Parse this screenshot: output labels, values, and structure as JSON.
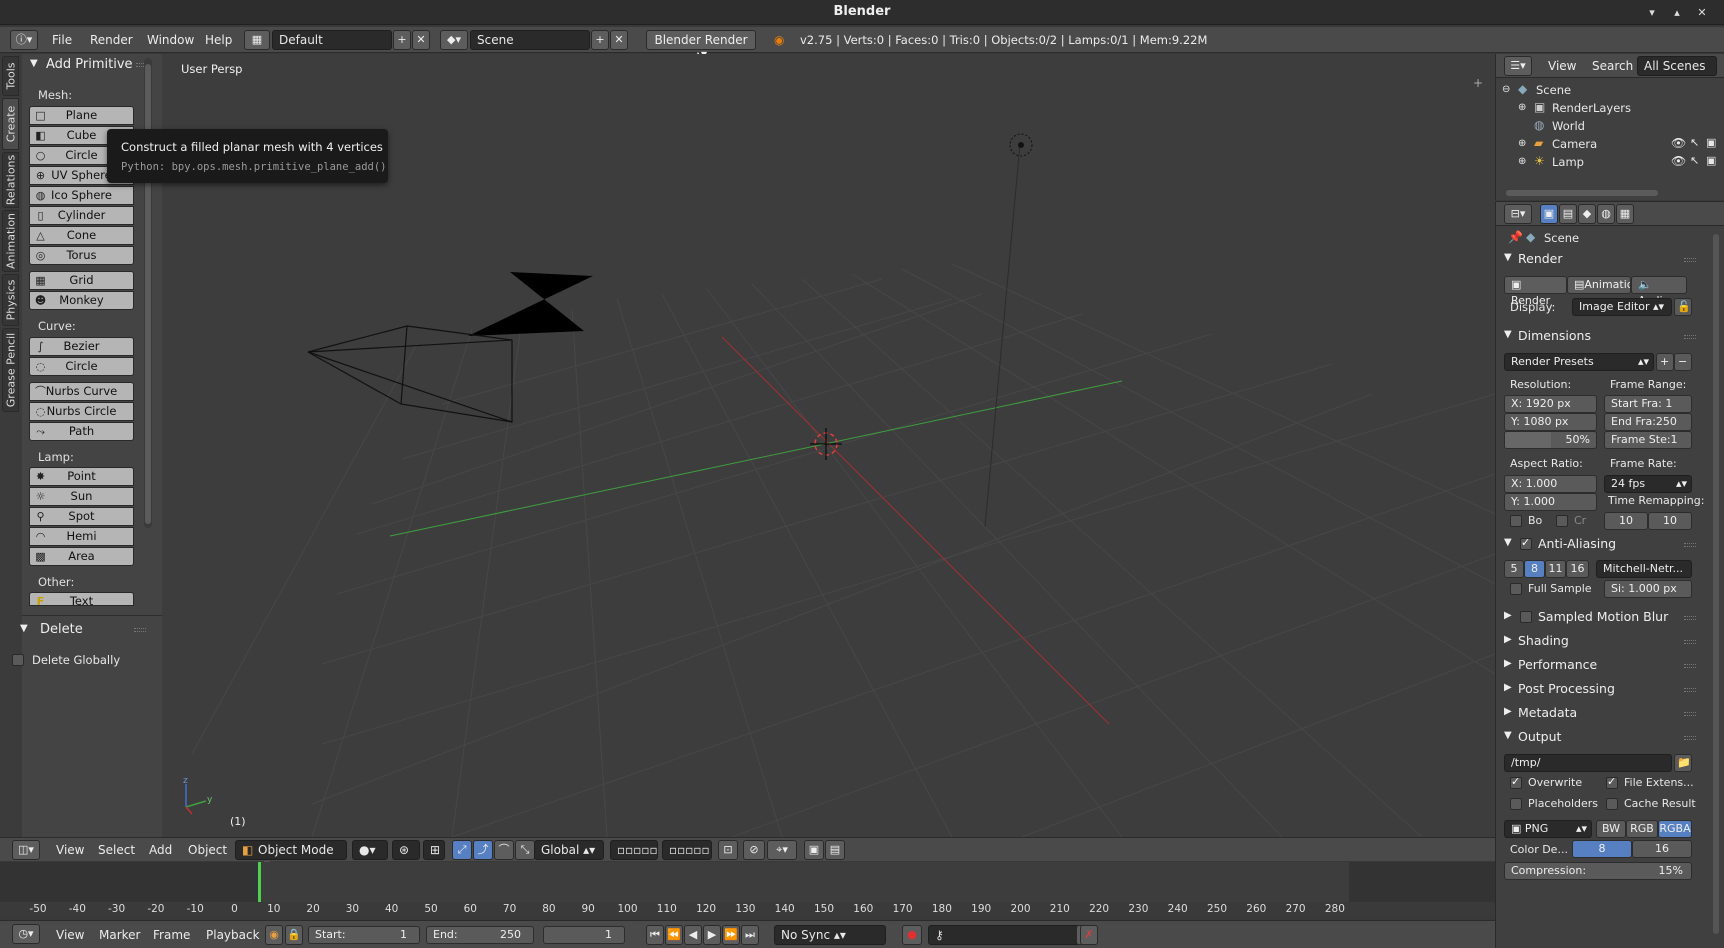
{
  "window": {
    "title": "Blender",
    "minimize": "▾",
    "maximize": "▴",
    "close": "✕"
  },
  "info": {
    "menus": [
      "File",
      "Render",
      "Window",
      "Help"
    ],
    "layout": "Default",
    "scene": "Scene",
    "engine": "Blender Render",
    "stats": "v2.75 | Verts:0 | Faces:0 | Tris:0 | Objects:0/2 | Lamps:0/1 | Mem:9.22M"
  },
  "tool_tabs": [
    "Tools",
    "Create",
    "Relations",
    "Animation",
    "Physics",
    "Grease Pencil"
  ],
  "toolshelf": {
    "panel_title": "Add Primitive",
    "mesh_label": "Mesh:",
    "mesh_items": [
      "Plane",
      "Cube",
      "Circle",
      "UV Sphere",
      "Ico Sphere",
      "Cylinder",
      "Cone",
      "Torus",
      "Grid",
      "Monkey"
    ],
    "curve_label": "Curve:",
    "curve_items": [
      "Bezier",
      "Circle",
      "Nurbs Curve",
      "Nurbs Circle",
      "Path"
    ],
    "lamp_label": "Lamp:",
    "lamp_items": [
      "Point",
      "Sun",
      "Spot",
      "Hemi",
      "Area"
    ],
    "other_label": "Other:",
    "other_items": [
      "Text"
    ],
    "delete_title": "Delete",
    "delete_globally": "Delete Globally"
  },
  "tooltip": {
    "title": "Construct a filled planar mesh with 4 vertices",
    "python": "Python: bpy.ops.mesh.primitive_plane_add()"
  },
  "viewport": {
    "label": "User Persp",
    "frame": "(1)",
    "x_axis_color": "#b03030",
    "y_axis_color": "#3f9f3f"
  },
  "vp_header": {
    "menus": [
      "View",
      "Select",
      "Add",
      "Object"
    ],
    "mode": "Object Mode",
    "orientation": "Global"
  },
  "timeline": {
    "ticks": [
      "-50",
      "-40",
      "-30",
      "-20",
      "-10",
      "0",
      "10",
      "20",
      "30",
      "40",
      "50",
      "60",
      "70",
      "80",
      "90",
      "100",
      "110",
      "120",
      "130",
      "140",
      "150",
      "160",
      "170",
      "180",
      "190",
      "200",
      "210",
      "220",
      "230",
      "240",
      "250",
      "260",
      "270",
      "280"
    ],
    "current_frame_marker": 0
  },
  "tl_header": {
    "menus": [
      "View",
      "Marker",
      "Frame",
      "Playback"
    ],
    "start_label": "Start:",
    "start": "1",
    "end_label": "End:",
    "end": "250",
    "current": "1",
    "sync": "No Sync"
  },
  "outliner": {
    "menus": [
      "View",
      "Search"
    ],
    "filter": "All Scenes",
    "items": [
      "Scene",
      "RenderLayers",
      "World",
      "Camera",
      "Lamp"
    ]
  },
  "props": {
    "context": "Scene",
    "render": {
      "title": "Render",
      "buttons": [
        "Render",
        "Animatio",
        "Audio"
      ],
      "display_label": "Display:",
      "display": "Image Editor"
    },
    "dimensions": {
      "title": "Dimensions",
      "presets": "Render Presets",
      "resolution_label": "Resolution:",
      "res_x": "X:  1920 px",
      "res_y": "Y:  1080 px",
      "res_pct": "50%",
      "frame_range_label": "Frame Range:",
      "start": "Start Fra:  1",
      "end": "End Fra:250",
      "step": "Frame Ste:1",
      "aspect_label": "Aspect Ratio:",
      "asp_x": "X:   1.000",
      "asp_y": "Y:   1.000",
      "frame_rate_label": "Frame Rate:",
      "fps": "24 fps",
      "remap_label": "Time Remapping:",
      "remap_old": "10",
      "remap_new": "10",
      "border": "Bo",
      "crop": "Cr"
    },
    "aa": {
      "title": "Anti-Aliasing",
      "samples": [
        "5",
        "8",
        "11",
        "16"
      ],
      "selected": "8",
      "filter": "Mitchell-Netr...",
      "full_sample": "Full Sample",
      "size": "Si: 1.000 px"
    },
    "collapsed": [
      "Sampled Motion Blur",
      "Shading",
      "Performance",
      "Post Processing",
      "Metadata"
    ],
    "output": {
      "title": "Output",
      "path": "/tmp/",
      "overwrite": "Overwrite",
      "file_ext": "File Extens...",
      "placeholders": "Placeholders",
      "cache": "Cache Result",
      "format": "PNG",
      "color_modes": [
        "BW",
        "RGB",
        "RGBA"
      ],
      "color_depth_label": "Color De...",
      "depths": [
        "8",
        "16"
      ],
      "compression": "Compression:",
      "compression_val": "15%"
    }
  },
  "colors": {
    "accent": "#5680c2",
    "highlight": "#5a8bd0"
  }
}
